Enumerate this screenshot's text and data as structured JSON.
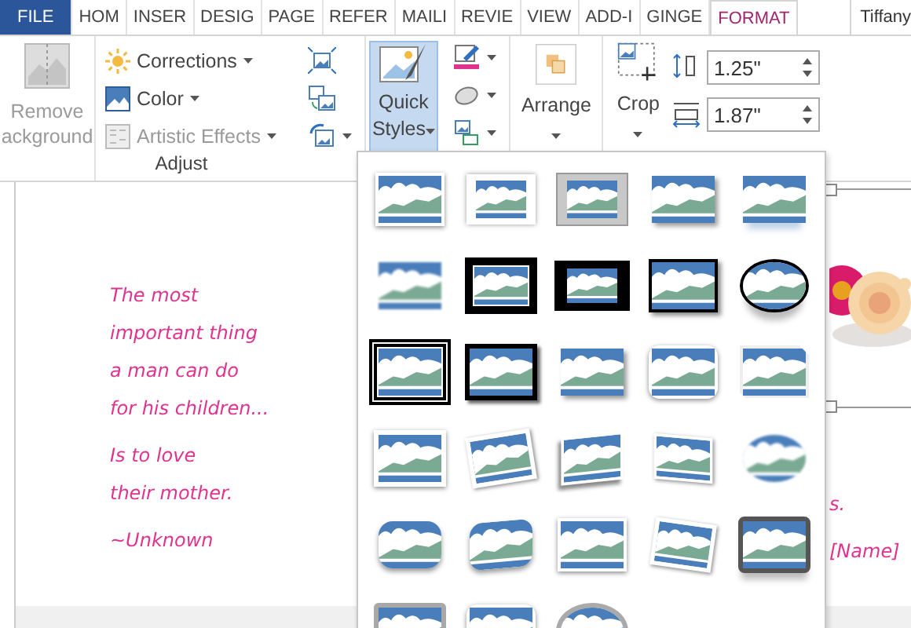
{
  "tabs": [
    {
      "label": "FILE",
      "kind": "file",
      "selected": false
    },
    {
      "label": "HOM",
      "kind": "tab",
      "selected": false
    },
    {
      "label": "INSER",
      "kind": "tab",
      "selected": false
    },
    {
      "label": "DESIG",
      "kind": "tab",
      "selected": false
    },
    {
      "label": "PAGE",
      "kind": "tab",
      "selected": false
    },
    {
      "label": "REFER",
      "kind": "tab",
      "selected": false
    },
    {
      "label": "MAILI",
      "kind": "tab",
      "selected": false
    },
    {
      "label": "REVIE",
      "kind": "tab",
      "selected": false
    },
    {
      "label": "VIEW",
      "kind": "tab",
      "selected": false
    },
    {
      "label": "ADD-I",
      "kind": "tab",
      "selected": false
    },
    {
      "label": "GINGE",
      "kind": "tab",
      "selected": false
    },
    {
      "label": "FORMAT",
      "kind": "tab",
      "selected": true
    }
  ],
  "user": "Tiffany",
  "ribbon": {
    "remove_background": {
      "lines": [
        "Remove",
        "ackground"
      ],
      "disabled": true
    },
    "adjust_commands": [
      {
        "label": "Corrections",
        "disabled": false
      },
      {
        "label": "Color",
        "disabled": false
      },
      {
        "label": "Artistic Effects",
        "disabled": true
      }
    ],
    "adjust_label": "Adjust",
    "quick_styles": {
      "lines": [
        "Quick",
        "Styles"
      ],
      "selected": true
    },
    "arrange": "Arrange",
    "crop": "Crop",
    "height": "1.25\"",
    "width": "1.87\""
  },
  "document": {
    "quote": [
      [
        "The most",
        "important thing",
        "a man can do",
        "for his children..."
      ],
      [
        "Is to love",
        "their mother."
      ],
      [
        "~Unknown"
      ]
    ],
    "right_lines": [
      "s.",
      "[Name]"
    ]
  },
  "gallery": [
    {
      "kind": "shadow-frame"
    },
    {
      "kind": "white-matte"
    },
    {
      "kind": "gray-matte"
    },
    {
      "kind": "drop-shadow"
    },
    {
      "kind": "reflected"
    },
    {
      "kind": "soft-edge"
    },
    {
      "kind": "double-black"
    },
    {
      "kind": "black-matte"
    },
    {
      "kind": "thin-black"
    },
    {
      "kind": "oval"
    },
    {
      "kind": "double-thin"
    },
    {
      "kind": "black-shadow"
    },
    {
      "kind": "drop-shadow"
    },
    {
      "kind": "rounded"
    },
    {
      "kind": "snip"
    },
    {
      "kind": "white-frame"
    },
    {
      "kind": "tilted"
    },
    {
      "kind": "skewed"
    },
    {
      "kind": "perspective"
    },
    {
      "kind": "soft-oval"
    },
    {
      "kind": "rounded-blue"
    },
    {
      "kind": "bevel-tilt"
    },
    {
      "kind": "shadow-frame"
    },
    {
      "kind": "tilted-right"
    },
    {
      "kind": "gray-rounded"
    },
    {
      "kind": "metal"
    },
    {
      "kind": "rounded"
    },
    {
      "kind": "metal-oval"
    }
  ]
}
